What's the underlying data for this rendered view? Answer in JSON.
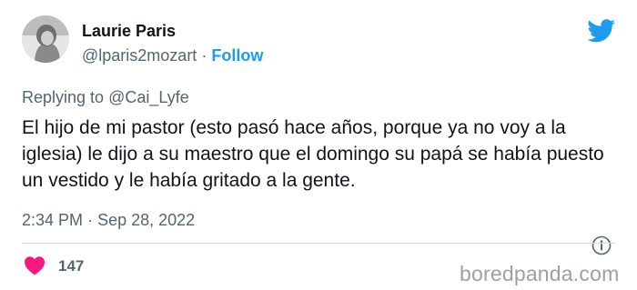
{
  "author": {
    "display_name": "Laurie Paris",
    "handle": "@lparis2mozart",
    "separator": "·",
    "follow_label": "Follow"
  },
  "reply": {
    "prefix": "Replying to",
    "mention": "@Cai_Lyfe"
  },
  "tweet": {
    "text": "El hijo de mi pastor (esto pasó hace años, porque ya no voy a la iglesia) le dijo a su maestro que el domingo su papá se había puesto un vestido y le había gritado a la gente.",
    "time": "2:34 PM",
    "date_separator": "·",
    "date": "Sep 28, 2022"
  },
  "engagement": {
    "likes": "147"
  },
  "icons": {
    "brand": "twitter-bird-icon",
    "info": "info-icon",
    "like": "heart-icon"
  },
  "colors": {
    "accent": "#1d9bf0",
    "like": "#f91880",
    "secondary_text": "#536471"
  },
  "watermark": "boredpanda.com"
}
